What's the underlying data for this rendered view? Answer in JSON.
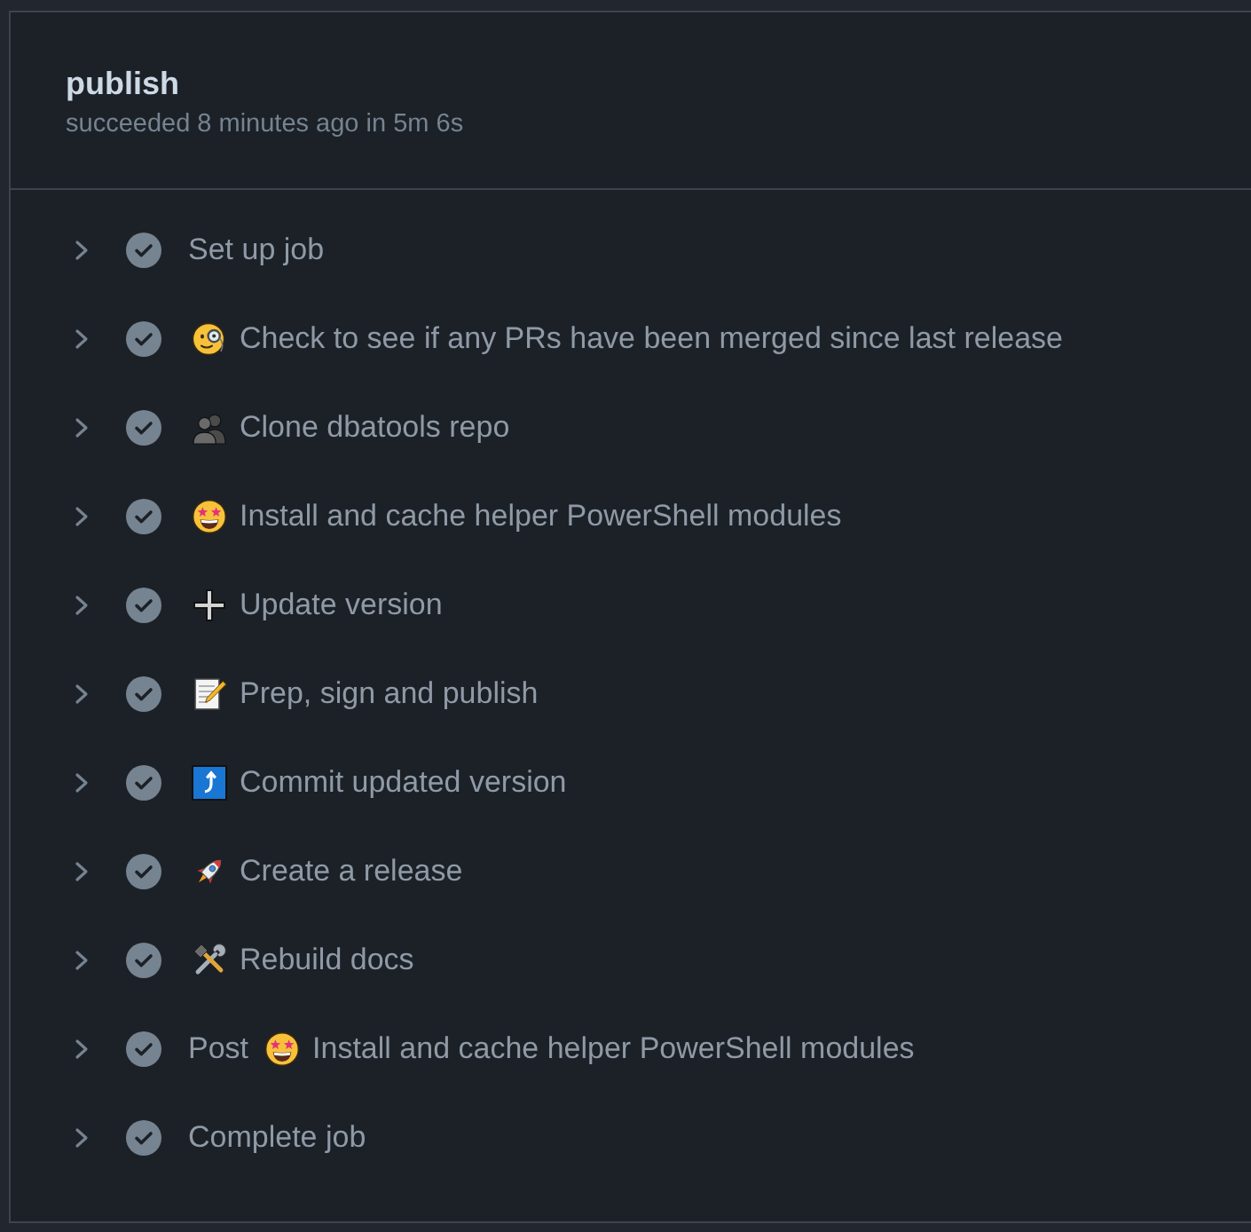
{
  "job": {
    "title": "publish",
    "summary": "succeeded 8 minutes ago in 5m 6s"
  },
  "steps": [
    {
      "expanded": false,
      "succeeded": true,
      "parts": [
        {
          "kind": "text",
          "text": "Set up job"
        }
      ]
    },
    {
      "expanded": false,
      "succeeded": true,
      "parts": [
        {
          "kind": "monocle-face"
        },
        {
          "kind": "text",
          "text": "Check to see if any PRs have been merged since last release"
        }
      ]
    },
    {
      "expanded": false,
      "succeeded": true,
      "parts": [
        {
          "kind": "silhouettes"
        },
        {
          "kind": "text",
          "text": "Clone dbatools repo"
        }
      ]
    },
    {
      "expanded": false,
      "succeeded": true,
      "parts": [
        {
          "kind": "star-eyes"
        },
        {
          "kind": "text",
          "text": "Install and cache helper PowerShell modules"
        }
      ]
    },
    {
      "expanded": false,
      "succeeded": true,
      "parts": [
        {
          "kind": "plus"
        },
        {
          "kind": "text",
          "text": "Update version"
        }
      ]
    },
    {
      "expanded": false,
      "succeeded": true,
      "parts": [
        {
          "kind": "memo"
        },
        {
          "kind": "text",
          "text": "Prep, sign and publish"
        }
      ]
    },
    {
      "expanded": false,
      "succeeded": true,
      "parts": [
        {
          "kind": "arrow-tile"
        },
        {
          "kind": "text",
          "text": "Commit updated version"
        }
      ]
    },
    {
      "expanded": false,
      "succeeded": true,
      "parts": [
        {
          "kind": "rocket"
        },
        {
          "kind": "text",
          "text": "Create a release"
        }
      ]
    },
    {
      "expanded": false,
      "succeeded": true,
      "parts": [
        {
          "kind": "tools"
        },
        {
          "kind": "text",
          "text": "Rebuild docs"
        }
      ]
    },
    {
      "expanded": false,
      "succeeded": true,
      "parts": [
        {
          "kind": "text",
          "text": "Post"
        },
        {
          "kind": "star-eyes"
        },
        {
          "kind": "text",
          "text": "Install and cache helper PowerShell modules"
        }
      ]
    },
    {
      "expanded": false,
      "succeeded": true,
      "parts": [
        {
          "kind": "text",
          "text": "Complete job"
        }
      ]
    }
  ]
}
